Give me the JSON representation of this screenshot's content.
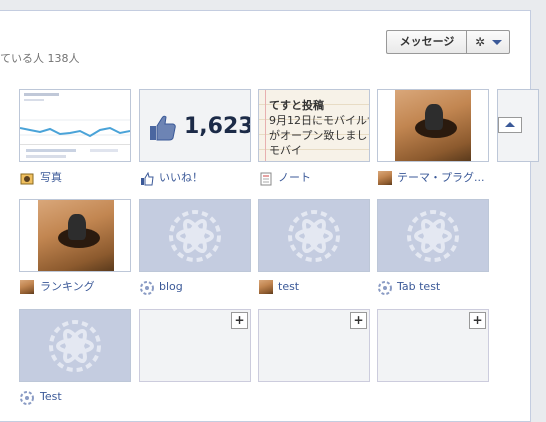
{
  "header": {
    "likes_text": "ている人 138人",
    "message_button": "メッセージ",
    "gear_glyph": "✲"
  },
  "row1": {
    "photos": {
      "label": "写真"
    },
    "likes": {
      "label": "いいね！",
      "count": "1,623"
    },
    "notes": {
      "label": "ノート",
      "title": "てすと投稿",
      "body": "9月12日にモバイルサ\nがオープン致しまし\nモバイ"
    },
    "theme": {
      "label": "テーマ・プラグ..."
    }
  },
  "row2": {
    "ranking": {
      "label": "ランキング"
    },
    "blog": {
      "label": "blog"
    },
    "test": {
      "label": "test"
    },
    "tab_test": {
      "label": "Tab test"
    }
  },
  "row3": {
    "test_app": {
      "label": "Test"
    },
    "plus_glyph": "+"
  },
  "colors": {
    "link": "#3b5998",
    "app_tile": "#c4cce0",
    "border": "#bdc7d8"
  }
}
